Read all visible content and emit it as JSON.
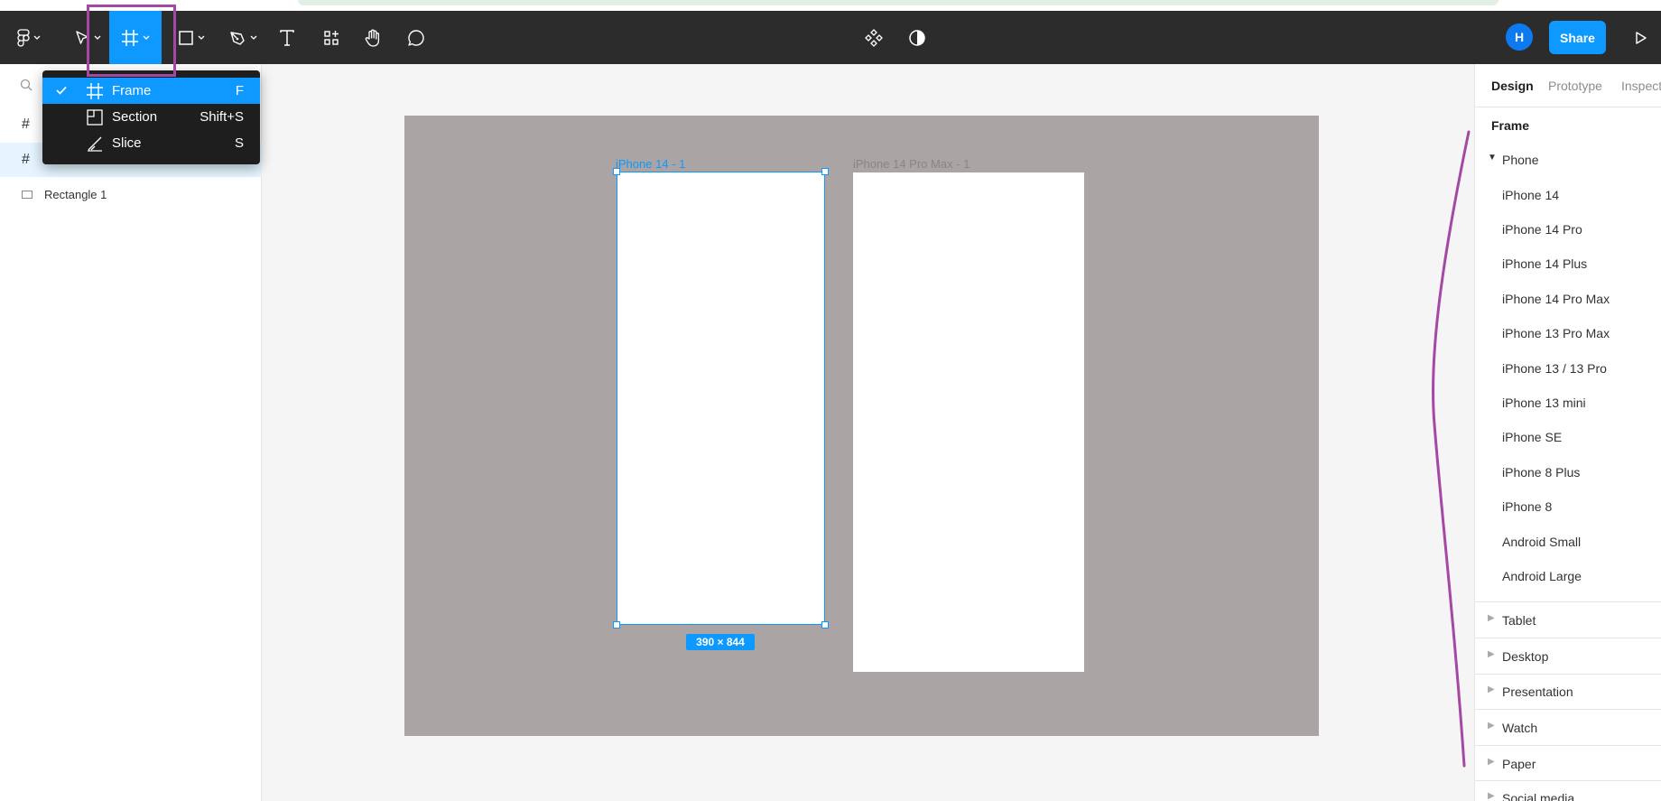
{
  "toolbar": {
    "share_label": "Share",
    "avatar_initial": "H",
    "highlight_color": "#a349a4",
    "accent_color": "#0d99ff"
  },
  "frame_menu": {
    "items": [
      {
        "label": "Frame",
        "shortcut": "F",
        "checked": true
      },
      {
        "label": "Section",
        "shortcut": "Shift+S",
        "checked": false
      },
      {
        "label": "Slice",
        "shortcut": "S",
        "checked": false
      }
    ]
  },
  "layers": {
    "items": [
      {
        "label": "Rectangle 1"
      }
    ]
  },
  "canvas": {
    "frame1_label": "iPhone 14 - 1",
    "frame2_label": "iPhone 14 Pro Max - 1",
    "size_badge": "390 × 844"
  },
  "right_panel": {
    "tabs": [
      "Design",
      "Prototype",
      "Inspect"
    ],
    "title": "Frame",
    "phone_section": "Phone",
    "phone_presets": [
      "iPhone 14",
      "iPhone 14 Pro",
      "iPhone 14 Plus",
      "iPhone 14 Pro Max",
      "iPhone 13 Pro Max",
      "iPhone 13 / 13 Pro",
      "iPhone 13 mini",
      "iPhone SE",
      "iPhone 8 Plus",
      "iPhone 8",
      "Android Small",
      "Android Large"
    ],
    "collapsed_sections": [
      "Tablet",
      "Desktop",
      "Presentation",
      "Watch",
      "Paper",
      "Social media"
    ]
  }
}
